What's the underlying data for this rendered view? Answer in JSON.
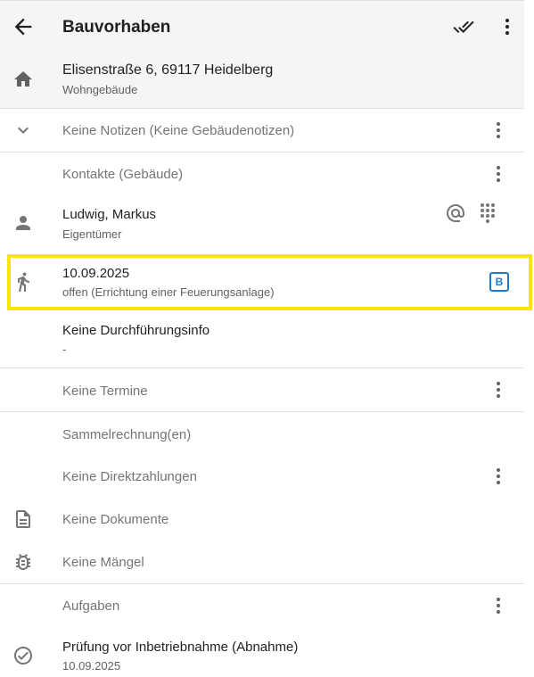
{
  "appbar": {
    "title": "Bauvorhaben"
  },
  "address": {
    "line": "Elisenstraße 6, 69117 Heidelberg",
    "type": "Wohngebäude"
  },
  "notes": {
    "label": "Keine Notizen (Keine Gebäudenotizen)"
  },
  "contacts": {
    "header": "Kontakte (Gebäude)",
    "person": {
      "name": "Ludwig, Markus",
      "role": "Eigentümer"
    }
  },
  "visit": {
    "date": "10.09.2025",
    "status": "offen (Errichtung einer Feuerungsanlage)",
    "badge": "B"
  },
  "execution": {
    "label": "Keine Durchführungsinfo",
    "value": "-"
  },
  "appointments": {
    "label": "Keine Termine"
  },
  "invoices": {
    "label": "Sammelrechnung(en)"
  },
  "payments": {
    "label": "Keine Direktzahlungen"
  },
  "documents": {
    "label": "Keine Dokumente"
  },
  "defects": {
    "label": "Keine Mängel"
  },
  "tasks": {
    "header": "Aufgaben",
    "item": {
      "title": "Prüfung vor Inbetriebnahme (Abnahme)",
      "date": "10.09.2025"
    }
  },
  "colors": {
    "highlight": "#f7e600",
    "badge": "#1e7bc8",
    "icon": "#757575"
  }
}
